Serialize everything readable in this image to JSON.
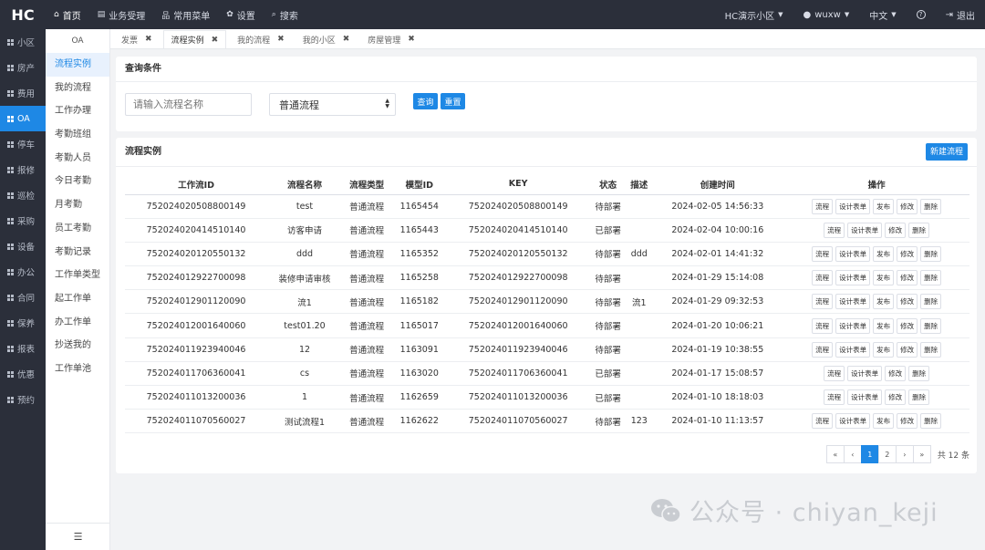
{
  "header": {
    "logo": "HC",
    "nav": [
      {
        "icon": "home-icon",
        "glyph": "⌂",
        "label": "首页",
        "active": true
      },
      {
        "icon": "briefcase-icon",
        "glyph": "▤",
        "label": "业务受理"
      },
      {
        "icon": "sitemap-icon",
        "glyph": "品",
        "label": "常用菜单"
      },
      {
        "icon": "gear-icon",
        "glyph": "✿",
        "label": "设置"
      },
      {
        "icon": "search-icon",
        "glyph": "⌕",
        "label": "搜索"
      }
    ],
    "community": "HC演示小区",
    "user": "wuxw",
    "language": "中文",
    "help_glyph": "?",
    "logout": "退出"
  },
  "sidebar": [
    {
      "label": "小区"
    },
    {
      "label": "房产"
    },
    {
      "label": "费用"
    },
    {
      "label": "OA",
      "active": true
    },
    {
      "label": "停车"
    },
    {
      "label": "报修"
    },
    {
      "label": "巡检"
    },
    {
      "label": "采购"
    },
    {
      "label": "设备"
    },
    {
      "label": "办公"
    },
    {
      "label": "合同"
    },
    {
      "label": "保养"
    },
    {
      "label": "报表"
    },
    {
      "label": "优惠"
    },
    {
      "label": "预约"
    }
  ],
  "submenu": {
    "title": "OA",
    "items": [
      "流程实例",
      "我的流程",
      "工作办理",
      "考勤班组",
      "考勤人员",
      "今日考勤",
      "月考勤",
      "员工考勤",
      "考勤记录",
      "工作单类型",
      "起工作单",
      "办工作单",
      "抄送我的",
      "工作单池"
    ],
    "collapse_glyph": "☰"
  },
  "tabs": [
    {
      "label": "发票"
    },
    {
      "label": "流程实例",
      "active": true
    },
    {
      "label": "我的流程"
    },
    {
      "label": "我的小区"
    },
    {
      "label": "房屋管理"
    }
  ],
  "query": {
    "title": "查询条件",
    "name_placeholder": "请输入流程名称",
    "type_value": "普通流程",
    "search_label": "查询",
    "reset_label": "重置"
  },
  "list": {
    "title": "流程实例",
    "new_label": "新建流程",
    "columns": [
      "工作流ID",
      "流程名称",
      "流程类型",
      "模型ID",
      "KEY",
      "状态",
      "描述",
      "创建时间",
      "操作"
    ],
    "ops_deploy": [
      "流程",
      "设计表单",
      "发布",
      "修改",
      "删除"
    ],
    "ops_deployed": [
      "流程",
      "设计表单",
      "修改",
      "删除"
    ],
    "rows": [
      {
        "id": "752024020508800149",
        "name": "test",
        "type": "普通流程",
        "model": "1165454",
        "key": "752024020508800149",
        "status": "待部署",
        "desc": "",
        "time": "2024-02-05 14:56:33"
      },
      {
        "id": "752024020414510140",
        "name": "访客申请",
        "type": "普通流程",
        "model": "1165443",
        "key": "752024020414510140",
        "status": "已部署",
        "desc": "",
        "time": "2024-02-04 10:00:16"
      },
      {
        "id": "752024020120550132",
        "name": "ddd",
        "type": "普通流程",
        "model": "1165352",
        "key": "752024020120550132",
        "status": "待部署",
        "desc": "ddd",
        "time": "2024-02-01 14:41:32"
      },
      {
        "id": "752024012922700098",
        "name": "装修申请审核",
        "type": "普通流程",
        "model": "1165258",
        "key": "752024012922700098",
        "status": "待部署",
        "desc": "",
        "time": "2024-01-29 15:14:08"
      },
      {
        "id": "752024012901120090",
        "name": "流1",
        "type": "普通流程",
        "model": "1165182",
        "key": "752024012901120090",
        "status": "待部署",
        "desc": "流1",
        "time": "2024-01-29 09:32:53"
      },
      {
        "id": "752024012001640060",
        "name": "test01.20",
        "type": "普通流程",
        "model": "1165017",
        "key": "752024012001640060",
        "status": "待部署",
        "desc": "",
        "time": "2024-01-20 10:06:21"
      },
      {
        "id": "752024011923940046",
        "name": "12",
        "type": "普通流程",
        "model": "1163091",
        "key": "752024011923940046",
        "status": "待部署",
        "desc": "",
        "time": "2024-01-19 10:38:55"
      },
      {
        "id": "752024011706360041",
        "name": "cs",
        "type": "普通流程",
        "model": "1163020",
        "key": "752024011706360041",
        "status": "已部署",
        "desc": "",
        "time": "2024-01-17 15:08:57"
      },
      {
        "id": "752024011013200036",
        "name": "1",
        "type": "普通流程",
        "model": "1162659",
        "key": "752024011013200036",
        "status": "已部署",
        "desc": "",
        "time": "2024-01-10 18:18:03"
      },
      {
        "id": "752024011070560027",
        "name": "测试流程1",
        "type": "普通流程",
        "model": "1162622",
        "key": "752024011070560027",
        "status": "待部署",
        "desc": "123",
        "time": "2024-01-10 11:13:57"
      }
    ]
  },
  "pagination": {
    "first": "«",
    "prev": "‹",
    "pages": [
      "1",
      "2"
    ],
    "current": "1",
    "next": "›",
    "last": "»",
    "total": "共 12 条"
  },
  "watermark": {
    "text": "公众号 · chiyan_keji"
  }
}
